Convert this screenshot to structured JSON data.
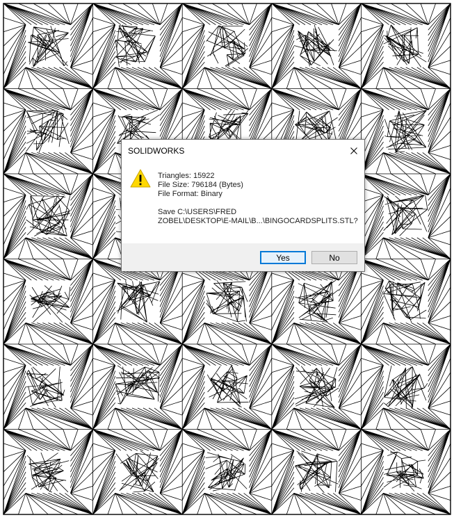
{
  "dialog": {
    "title": "SOLIDWORKS",
    "close_glyph": "✕",
    "icon": "warning-icon",
    "lines": {
      "triangles": "Triangles: 15922",
      "file_size": "File Size: 796184 (Bytes)",
      "file_format": "File Format: Binary",
      "save_line1": "Save C:\\USERS\\FRED",
      "save_line2": "ZOBEL\\DESKTOP\\E-MAIL\\B...\\BINGOCARDSPLITS.STL?"
    },
    "buttons": {
      "yes": "Yes",
      "no": "No"
    }
  },
  "colors": {
    "mesh_stroke": "#000000",
    "background": "#ffffff",
    "warning_fill": "#ffd800",
    "accent": "#0078d7"
  }
}
